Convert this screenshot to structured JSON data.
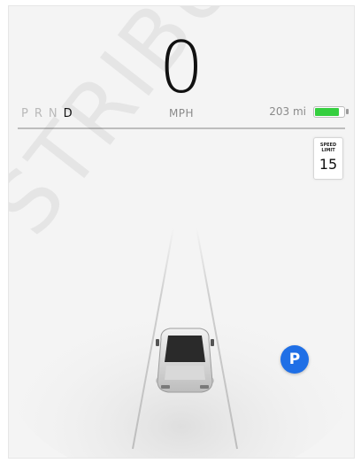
{
  "speed": {
    "value": "0",
    "unit": "MPH"
  },
  "gears": [
    {
      "label": "P",
      "active": false
    },
    {
      "label": "R",
      "active": false
    },
    {
      "label": "N",
      "active": false
    },
    {
      "label": "D",
      "active": true
    }
  ],
  "range": {
    "text": "203 mi",
    "battery_level": 0.85,
    "battery_color": "#35cf3f"
  },
  "speed_limit": {
    "label": "SPEED\nLIMIT",
    "value": "15"
  },
  "parking": {
    "label": "P",
    "color": "#1f6fe6"
  },
  "watermark": {
    "text": "STRIBUTE"
  },
  "vehicle": {
    "icon": "car-icon"
  }
}
